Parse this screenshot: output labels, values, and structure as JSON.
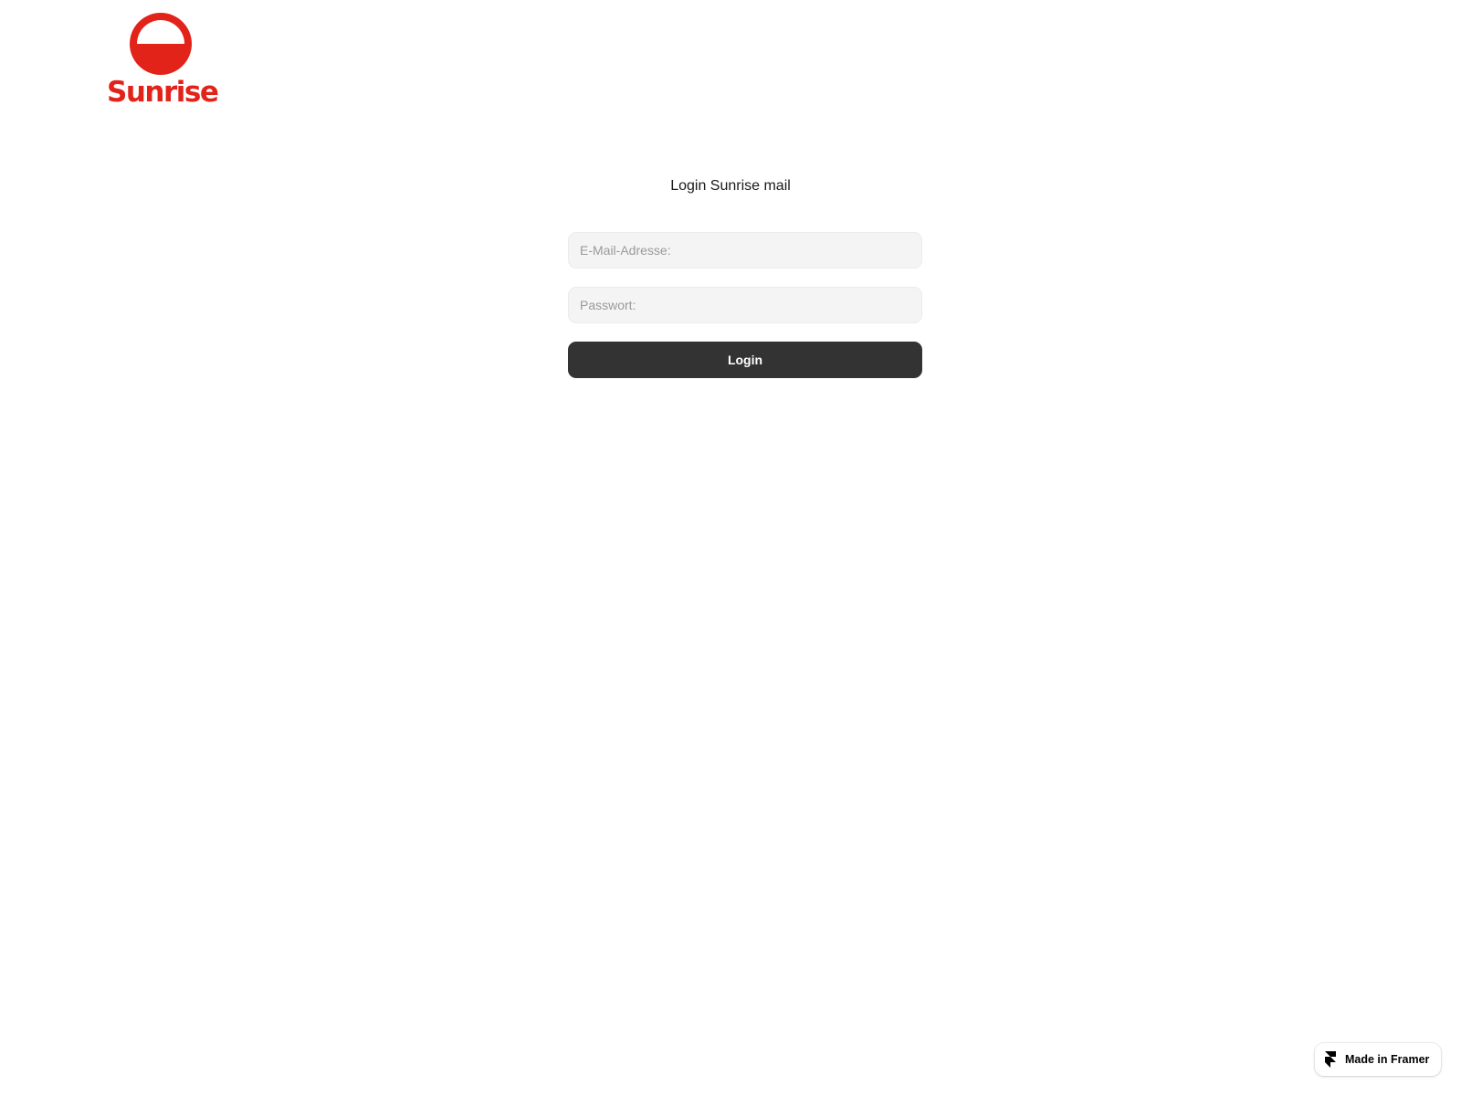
{
  "brand": {
    "name": "Sunrise",
    "color": "#e2231a",
    "icon": "sunrise-logo-icon"
  },
  "login": {
    "title": "Login Sunrise mail",
    "email_placeholder": "E-Mail-Adresse:",
    "email_value": "",
    "password_placeholder": "Passwort:",
    "password_value": "",
    "button_label": "Login",
    "button_color": "#333333"
  },
  "badge": {
    "label": "Made in Framer",
    "icon": "framer-icon"
  }
}
